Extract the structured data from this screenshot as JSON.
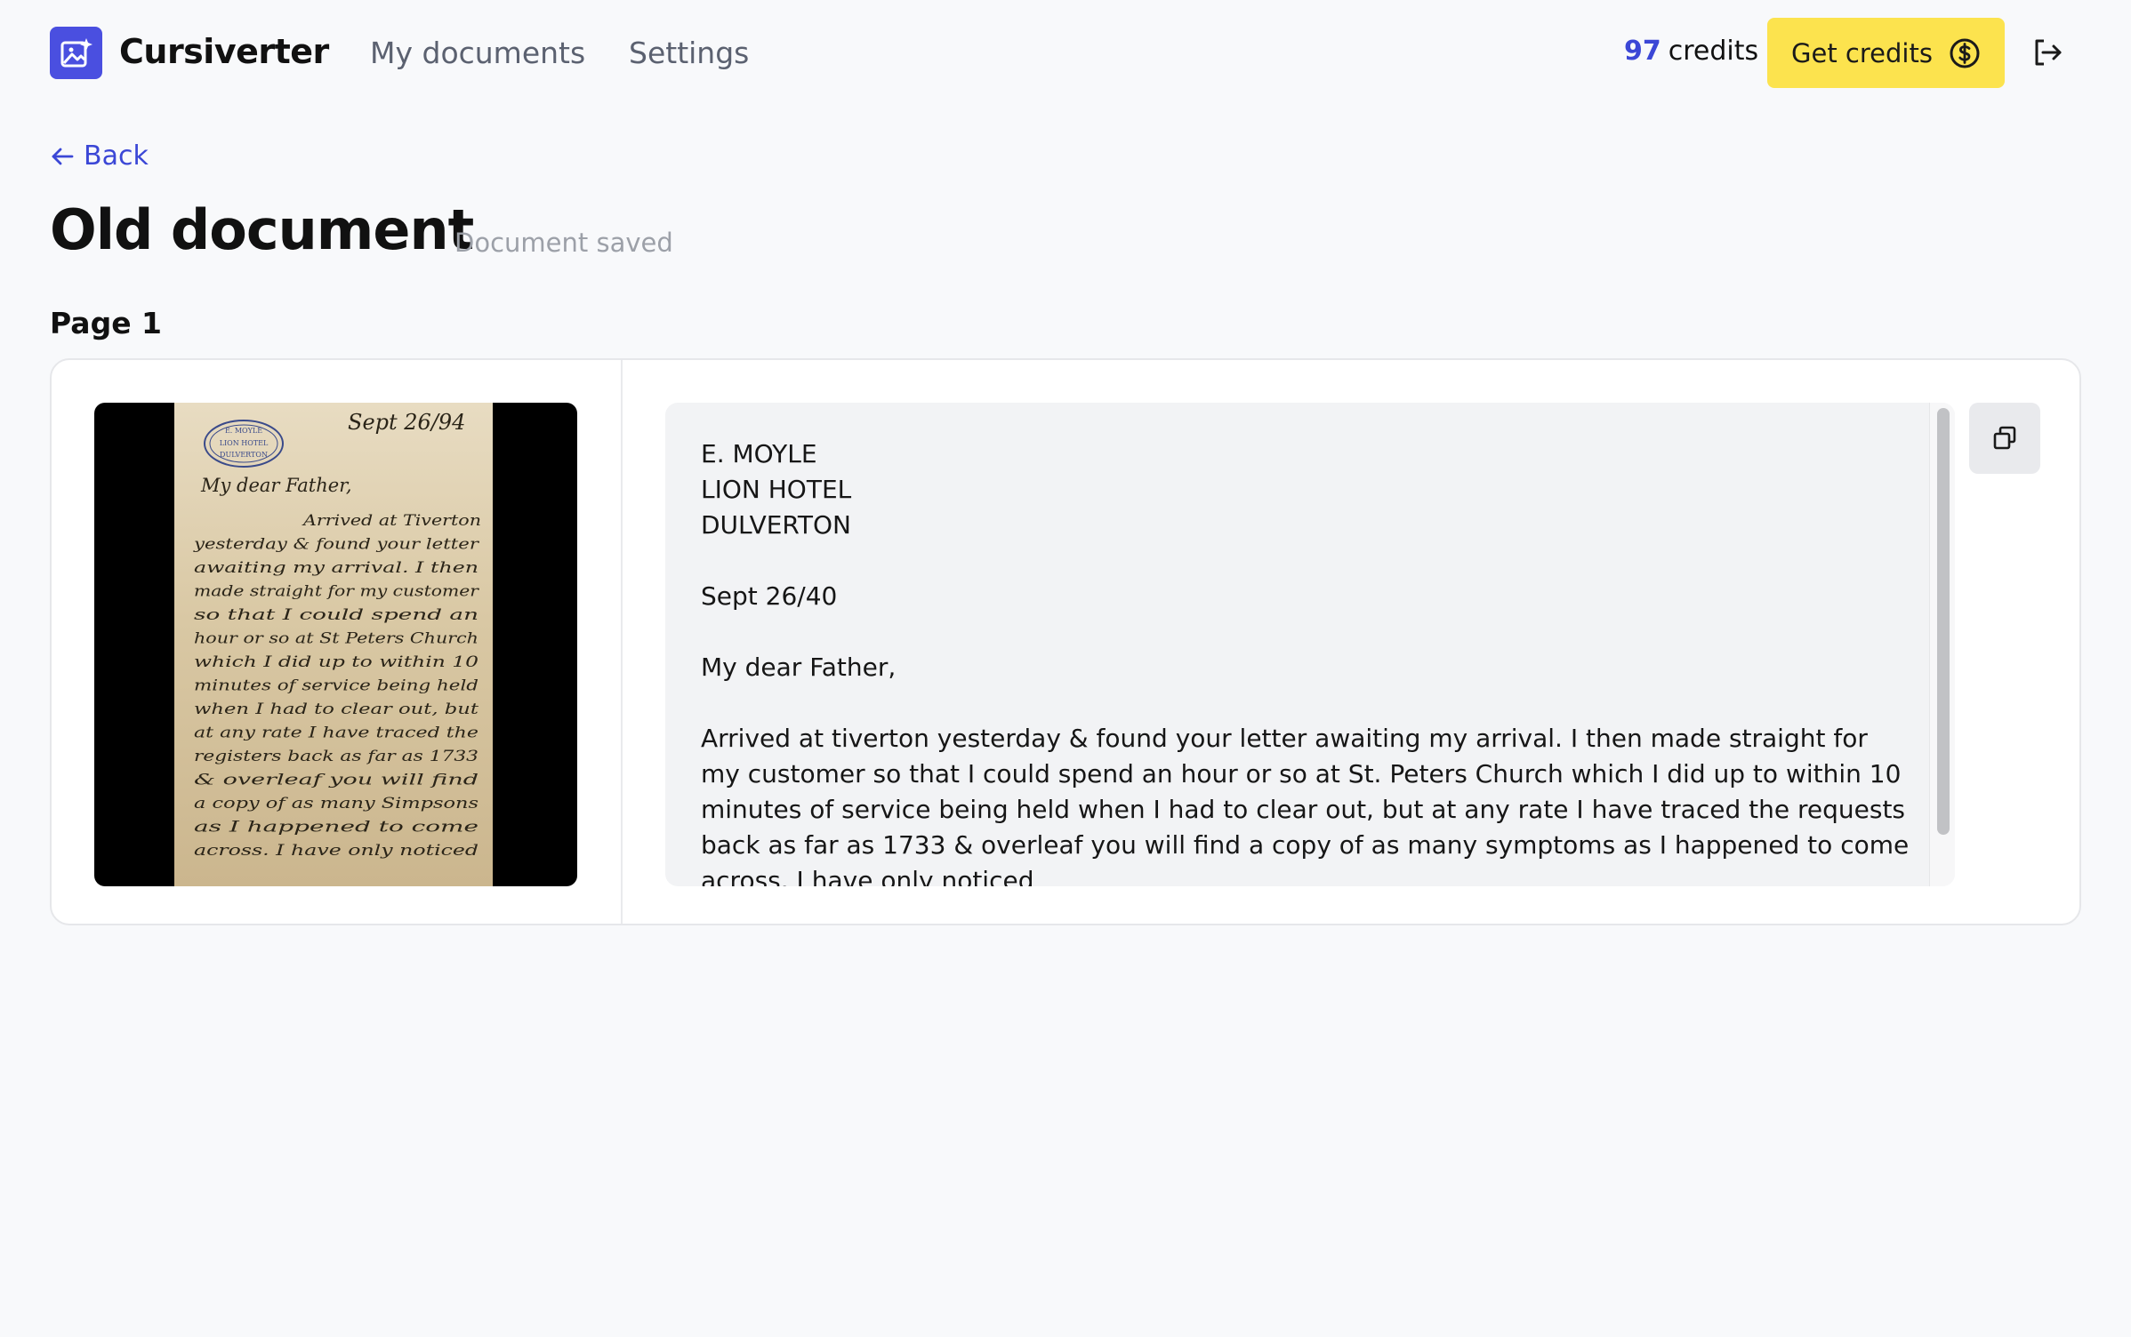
{
  "header": {
    "brand": "Cursiverter",
    "nav": [
      "My documents",
      "Settings"
    ],
    "credits_count": "97",
    "credits_label": "credits",
    "get_credits_label": "Get credits"
  },
  "nav_back": "Back",
  "document": {
    "title": "Old document",
    "status": "Document saved",
    "page_label": "Page 1",
    "transcription": "E. MOYLE\nLION HOTEL\nDULVERTON\n\nSept 26/40\n\nMy dear Father,\n\nArrived at tiverton yesterday & found your letter awaiting my arrival. I then made straight for my customer so that I could spend an hour or so at St. Peters Church which I did up to within 10 minutes of service being held when I had to clear out, but at any rate I have traced the requests back as far as 1733 & overleaf you will find a copy of as many symptoms as I happened to come across. I have only noticed"
  },
  "letter_image": {
    "stamp_lines": [
      "E. MOYLE",
      "LION HOTEL",
      "DULVERTON"
    ],
    "date": "Sept 26/94",
    "salutation": "My dear Father,",
    "lines": [
      "Arrived at Tiverton",
      "yesterday & found your letter",
      "awaiting my arrival. I then",
      "made straight for my customer",
      "so that I could spend an",
      "hour or so at St Peters Church",
      "which I did up to within 10",
      "minutes of service being held",
      "when I had to clear out, but",
      "at any rate I have traced the",
      "registers back as far as 1733",
      "& overleaf you will find",
      "a copy of as many Simpsons",
      "as I happened to come",
      "across. I have only noticed"
    ]
  },
  "icons": {
    "logo": "image-sparkle-icon",
    "dollar": "dollar-circle-icon",
    "logout": "logout-icon",
    "back": "arrow-left-icon",
    "copy": "copy-icon"
  },
  "colors": {
    "accent": "#3b47d6",
    "logo_bg": "#4a4fe0",
    "credits_button": "#fce34e",
    "page_bg": "#f8f9fb"
  }
}
